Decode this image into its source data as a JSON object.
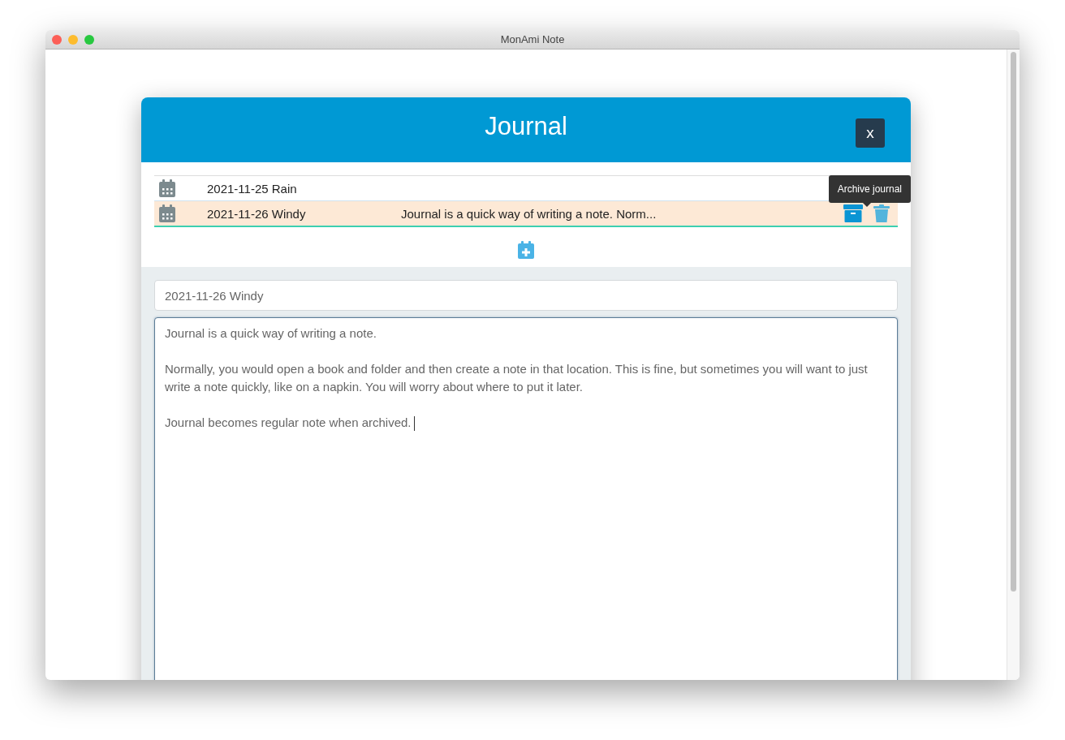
{
  "window": {
    "title": "MonAmi Note"
  },
  "dialog": {
    "title": "Journal",
    "close_label": "x"
  },
  "journals": [
    {
      "title": "2021-11-25 Rain",
      "selected": false
    },
    {
      "title": "2021-11-26 Windy",
      "preview": "Journal is a quick way of writing a note. Norm...",
      "selected": true
    }
  ],
  "tooltip": "Archive journal",
  "editor": {
    "title_value": "2021-11-26 Windy",
    "paragraphs": [
      "Journal is a quick way of writing a note.",
      "Normally, you would open a book and folder and then create a note in that location. This is fine, but sometimes you will want to just write a note quickly, like on a napkin. You will worry about where to put it later.",
      "Journal becomes regular note when archived."
    ]
  }
}
